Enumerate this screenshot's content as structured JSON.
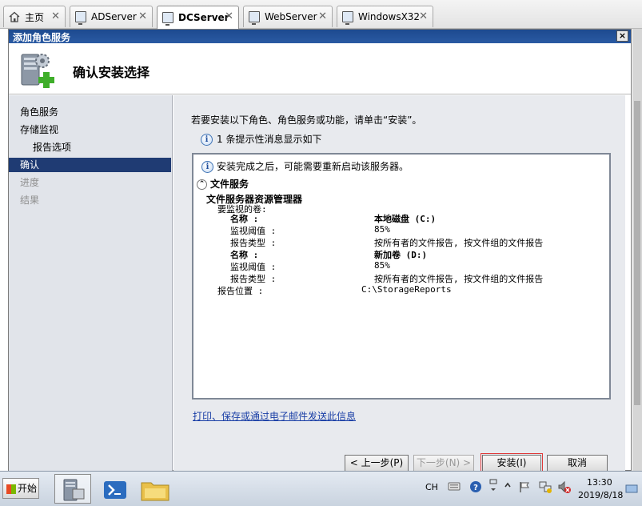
{
  "tabs": [
    {
      "label": "主页",
      "icon": "home-icon"
    },
    {
      "label": "ADServer",
      "icon": "monitor-icon"
    },
    {
      "label": "DCServer",
      "icon": "monitor-icon",
      "active": true
    },
    {
      "label": "WebServer",
      "icon": "monitor-icon"
    },
    {
      "label": "WindowsX32",
      "icon": "monitor-icon"
    }
  ],
  "dialog": {
    "title": "添加角色服务",
    "close": "×"
  },
  "header": {
    "title": "确认安装选择",
    "icon": "server-add-icon"
  },
  "nav": {
    "items": [
      {
        "label": "角色服务",
        "state": "normal"
      },
      {
        "label": "存储监视",
        "state": "normal"
      },
      {
        "label": "报告选项",
        "state": "sub"
      },
      {
        "label": "确认",
        "state": "active"
      },
      {
        "label": "进度",
        "state": "disabled"
      },
      {
        "label": "结果",
        "state": "disabled"
      }
    ]
  },
  "content": {
    "intro": "若要安装以下角色、角色服务或功能，请单击“安装”。",
    "hint": "1 条提示性消息显示如下",
    "notice": "安装完成之后，可能需要重新启动该服务器。",
    "section": "文件服务",
    "subsection": "文件服务器资源管理器",
    "volumes_label": "要监视的卷:",
    "volumes": [
      {
        "name_label": "名称 :",
        "name": "本地磁盘 (C:)",
        "threshold_label": "监视阈值 :",
        "threshold": "85%",
        "report_label": "报告类型 :",
        "report": "按所有者的文件报告, 按文件组的文件报告"
      },
      {
        "name_label": "名称 :",
        "name": "新加卷 (D:)",
        "threshold_label": "监视阈值 :",
        "threshold": "85%",
        "report_label": "报告类型 :",
        "report": "按所有者的文件报告, 按文件组的文件报告"
      }
    ],
    "report_location_label": "报告位置 :",
    "report_location": "C:\\StorageReports",
    "link": "打印、保存或通过电子邮件发送此信息"
  },
  "buttons": {
    "back": "< 上一步(P)",
    "next": "下一步(N) >",
    "install": "安装(I)",
    "cancel": "取消"
  },
  "taskbar": {
    "start": "开始",
    "lang": "CH",
    "time": "13:30",
    "date": "2019/8/18"
  },
  "colors": {
    "titlebar": "#1d4a8f",
    "nav_active": "#1f3b73",
    "link": "#1a3fa6",
    "highlight_ring": "#e03a3a"
  }
}
